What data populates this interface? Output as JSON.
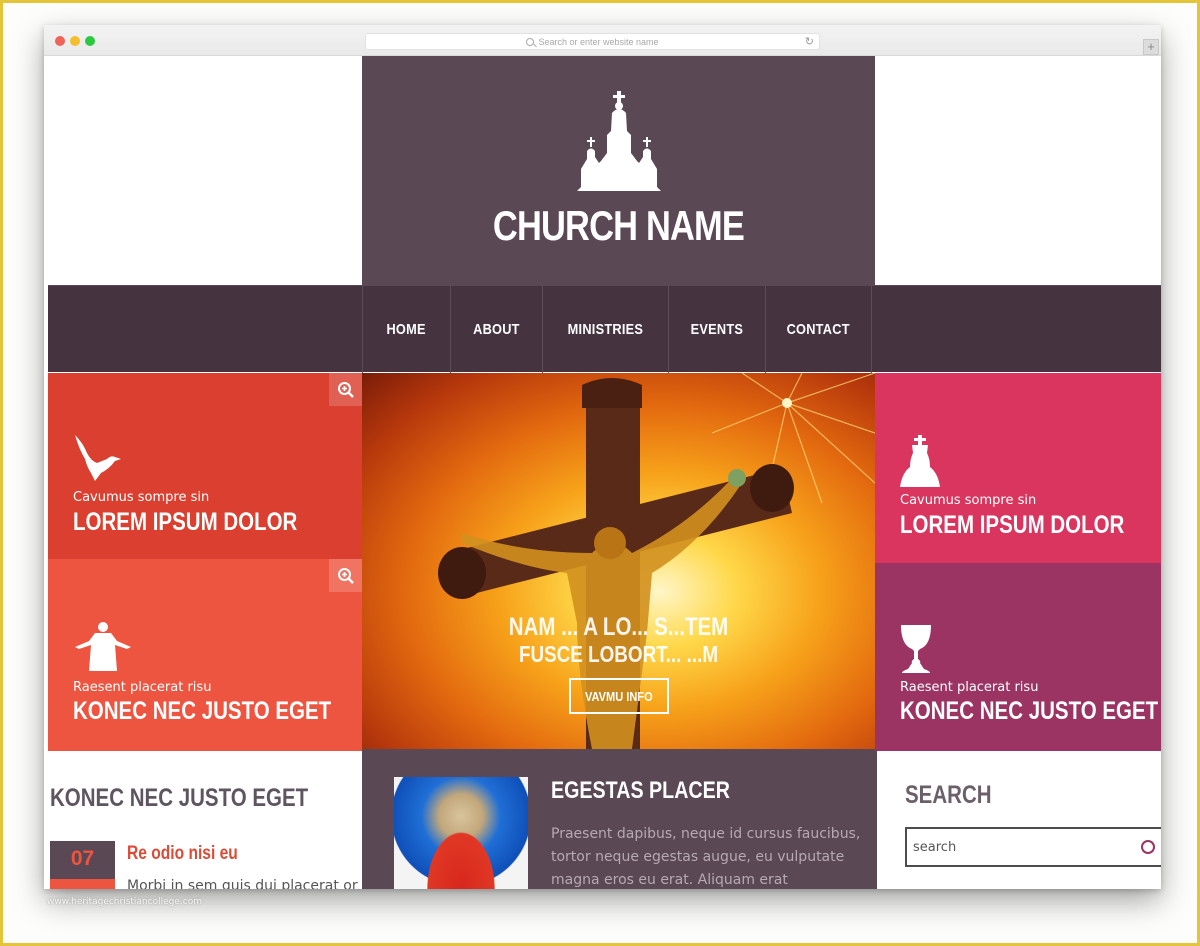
{
  "browser": {
    "url_placeholder": "Search or enter website name",
    "new_tab_label": "+"
  },
  "header": {
    "site_title": "CHURCH NAME",
    "logo_icon": "church-icon"
  },
  "nav": {
    "items": [
      {
        "label": "HOME"
      },
      {
        "label": "ABOUT"
      },
      {
        "label": "MINISTRIES"
      },
      {
        "label": "EVENTS"
      },
      {
        "label": "CONTACT"
      }
    ]
  },
  "tiles": [
    {
      "subtitle": "Cavumus sompre sin",
      "title": "LOREM IPSUM DOLOR",
      "icon": "dove-icon",
      "color": "#da3f2f"
    },
    {
      "subtitle": "Raesent placerat risu",
      "title": "KONEC NEC JUSTO EGET",
      "icon": "robed-figure-icon",
      "color": "#ee5540"
    },
    {
      "subtitle": "Cavumus sompre sin",
      "title": "LOREM IPSUM DOLOR",
      "icon": "chess-king-icon",
      "color": "#d9355e"
    },
    {
      "subtitle": "Raesent placerat risu",
      "title": "KONEC NEC JUSTO EGET",
      "icon": "chalice-icon",
      "color": "#9b3363"
    }
  ],
  "hero": {
    "line1": "NAM ... A LO... S...TEM",
    "line2": "FUSCE LOBORT... ...M",
    "button_label": "VAVMU INFO"
  },
  "left_section": {
    "title": "KONEC NEC JUSTO EGET",
    "post": {
      "date": "07",
      "title": "Re odio nisi eu",
      "excerpt": "Morbi in sem quis dui placerat or"
    }
  },
  "middle_section": {
    "title": "EGESTAS PLACER",
    "text": "Praesent dapibus, neque id cursus faucibus, tortor neque egestas augue, eu vulputate magna eros eu erat. Aliquam erat"
  },
  "right_section": {
    "title": "SEARCH",
    "search_value": "search"
  },
  "watermark": "www.heritagechristiancollege.com",
  "colors": {
    "header_bg": "#5a4854",
    "nav_bg": "#45343f",
    "accent_red": "#da3f2f",
    "accent_coral": "#ee5540",
    "accent_pink": "#d9355e",
    "accent_plum": "#9b3363"
  }
}
